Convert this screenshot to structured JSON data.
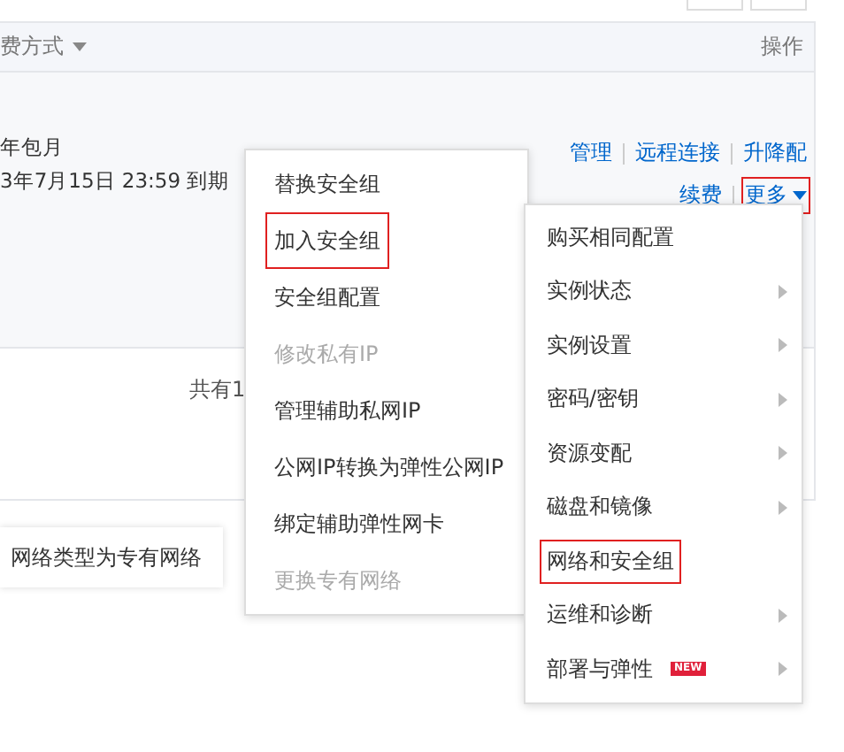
{
  "table": {
    "columns": [
      {
        "label": "费方式",
        "sortable": true
      },
      {
        "label": "操作",
        "sortable": false
      }
    ],
    "row": {
      "billing": "年包月",
      "expiry": "3年7月15日 23:59 到期",
      "actions": [
        {
          "label": "管理",
          "highlighted": false
        },
        {
          "label": "远程连接",
          "highlighted": false
        },
        {
          "label": "升降配",
          "highlighted": false
        },
        {
          "label": "续费",
          "highlighted": false
        },
        {
          "label": "更多",
          "highlighted": true
        }
      ]
    },
    "footer": "共有1"
  },
  "tooltip": "网络类型为专有网络",
  "more_menu": [
    {
      "label": "购买相同配置",
      "submenu": false,
      "highlighted": false
    },
    {
      "label": "实例状态",
      "submenu": true,
      "highlighted": false
    },
    {
      "label": "实例设置",
      "submenu": true,
      "highlighted": false
    },
    {
      "label": "密码/密钥",
      "submenu": true,
      "highlighted": false
    },
    {
      "label": "资源变配",
      "submenu": true,
      "highlighted": false
    },
    {
      "label": "磁盘和镜像",
      "submenu": true,
      "highlighted": false
    },
    {
      "label": "网络和安全组",
      "submenu": false,
      "highlighted": true
    },
    {
      "label": "运维和诊断",
      "submenu": true,
      "highlighted": false
    },
    {
      "label": "部署与弹性",
      "submenu": true,
      "highlighted": false,
      "badge": "NEW"
    }
  ],
  "sub_menu": [
    {
      "label": "替换安全组",
      "disabled": false,
      "highlighted": false
    },
    {
      "label": "加入安全组",
      "disabled": false,
      "highlighted": true
    },
    {
      "label": "安全组配置",
      "disabled": false,
      "highlighted": false
    },
    {
      "label": "修改私有IP",
      "disabled": true,
      "highlighted": false
    },
    {
      "label": "管理辅助私网IP",
      "disabled": false,
      "highlighted": false
    },
    {
      "label": "公网IP转换为弹性公网IP",
      "disabled": false,
      "highlighted": false
    },
    {
      "label": "绑定辅助弹性网卡",
      "disabled": false,
      "highlighted": false
    },
    {
      "label": "更换专有网络",
      "disabled": true,
      "highlighted": false
    }
  ]
}
